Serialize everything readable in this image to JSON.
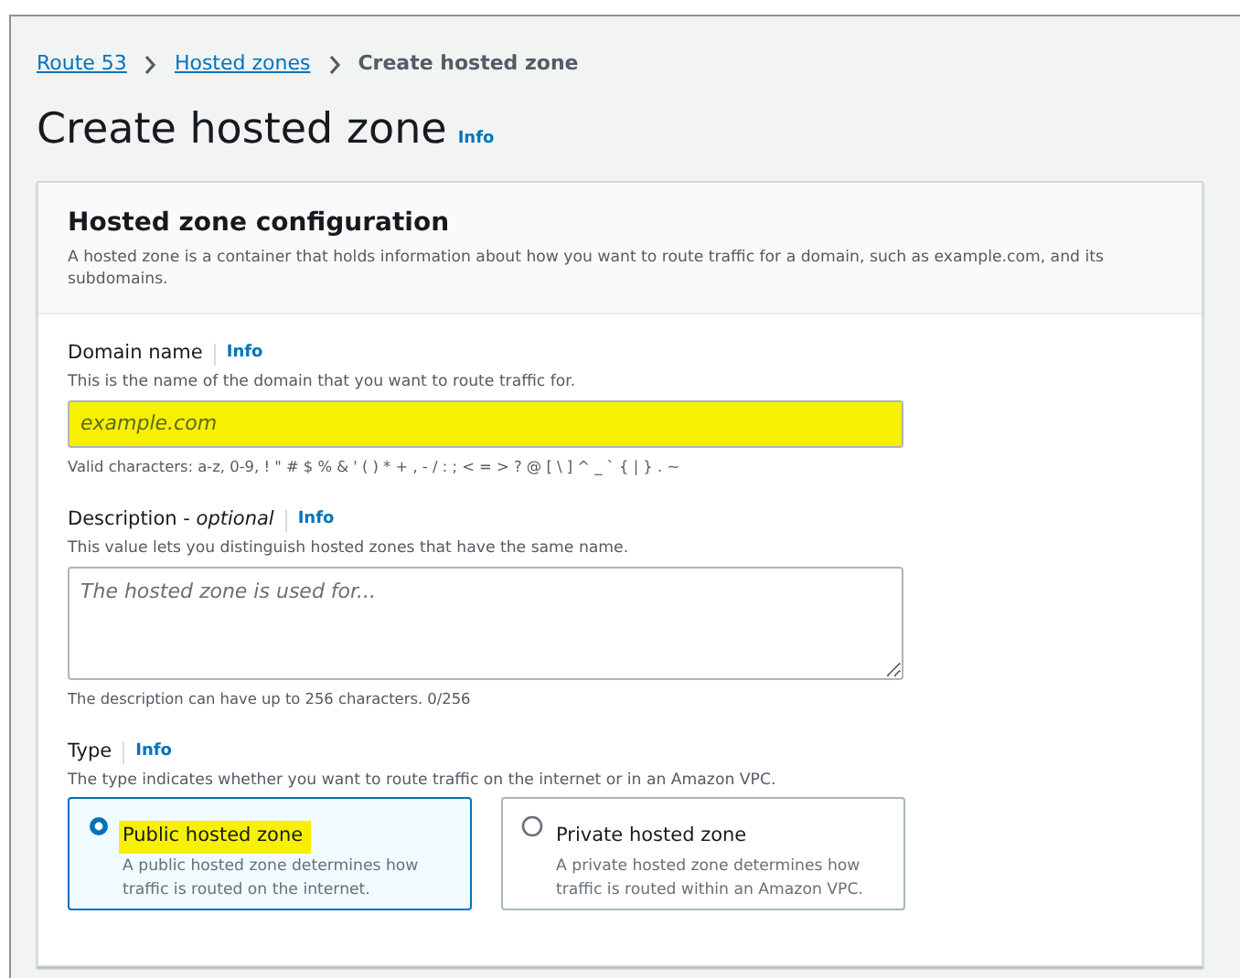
{
  "breadcrumb": [
    {
      "label": "Route 53",
      "link": true
    },
    {
      "label": "Hosted zones",
      "link": true
    },
    {
      "label": "Create hosted zone",
      "link": false
    }
  ],
  "page_title": "Create hosted zone",
  "page_info": "Info",
  "panel": {
    "title": "Hosted zone configuration",
    "description": "A hosted zone is a container that holds information about how you want to route traffic for a domain, such as example.com, and its subdomains."
  },
  "fields": [
    {
      "kind": "input",
      "label": "Domain name",
      "info": "Info",
      "hint": "This is the name of the domain that you want to route traffic for.",
      "placeholder": "example.com",
      "highlighted": true,
      "constraint": "Valid characters: a-z, 0-9, ! \" # $ % & ' ( ) * + , - / : ; < = > ? @ [ \\ ] ^ _ ` { | } . ~"
    },
    {
      "kind": "textarea",
      "label": "Description - *optional*",
      "info": "Info",
      "hint": "This value lets you distinguish hosted zones that have the same name.",
      "placeholder": "The hosted zone is used for...",
      "highlighted": false,
      "constraint": "The description can have up to 256 characters. 0/256"
    },
    {
      "kind": "radio",
      "label": "Type",
      "info": "Info",
      "hint": "The type indicates whether you want to route traffic on the internet or in an Amazon VPC.",
      "options": [
        {
          "label": "Public hosted zone",
          "description": "A public hosted zone determines how traffic is routed on the internet.",
          "selected": true,
          "highlighted": true
        },
        {
          "label": "Private hosted zone",
          "description": "A private hosted zone determines how traffic is routed within an Amazon VPC.",
          "selected": false,
          "highlighted": false
        }
      ]
    }
  ]
}
